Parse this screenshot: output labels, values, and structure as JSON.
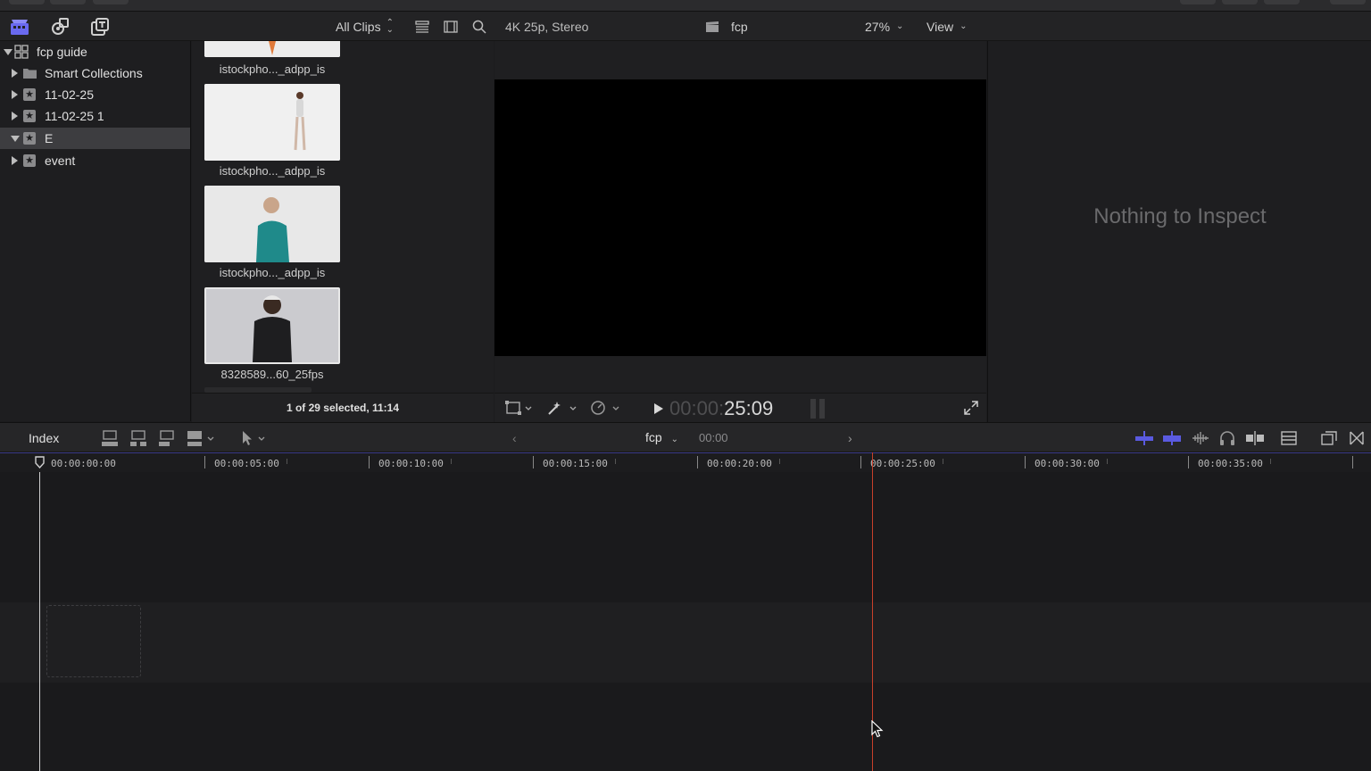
{
  "toolbar": {
    "all_clips_label": "All Clips",
    "format_label": "4K 25p, Stereo",
    "project_name": "fcp",
    "zoom_label": "27%",
    "view_label": "View"
  },
  "sidebar": {
    "items": [
      {
        "label": "fcp guide"
      },
      {
        "label": "Smart Collections"
      },
      {
        "label": "11-02-25"
      },
      {
        "label": "11-02-25 1"
      },
      {
        "label": "E"
      },
      {
        "label": "event"
      }
    ]
  },
  "browser": {
    "clips": [
      {
        "label": "istockpho..._adpp_is"
      },
      {
        "label": "istockpho..._adpp_is"
      },
      {
        "label": "istockpho..._adpp_is"
      },
      {
        "label": "8328589...60_25fps"
      }
    ],
    "footer": "1 of 29 selected, 11:14"
  },
  "viewer": {
    "timecode_dim": "00:00:",
    "timecode": "25:09"
  },
  "inspector": {
    "empty_text": "Nothing to Inspect"
  },
  "timeline": {
    "index_label": "Index",
    "project_name": "fcp",
    "duration": "00:00",
    "ruler": [
      "00:00:00:00",
      "00:00:05:00",
      "00:00:10:00",
      "00:00:15:00",
      "00:00:20:00",
      "00:00:25:00",
      "00:00:30:00",
      "00:00:35:00"
    ]
  },
  "colors": {
    "accent": "#6a6af0",
    "skimmer": "#c8402a"
  }
}
